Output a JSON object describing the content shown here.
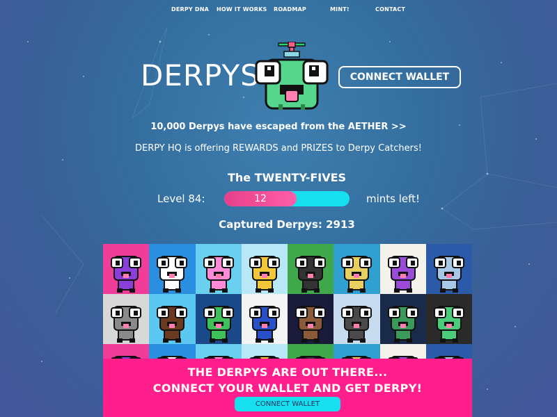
{
  "nav": {
    "items": [
      "DERPY DNA",
      "HOW IT WORKS",
      "ROADMAP",
      "MINT!",
      "CONTACT"
    ]
  },
  "hero": {
    "title": "DERPYS",
    "connect_label": "CONNECT WALLET",
    "mascot_icon": "derpy-frog-helicopter-icon"
  },
  "intro": {
    "line1": "10,000 Derpys have escaped from the AETHER >>",
    "line2": "DERPY HQ is offering REWARDS and PRIZES to Derpy Catchers!"
  },
  "mint": {
    "section_title": "The TWENTY-FIVES",
    "level_label": "Level 84:",
    "mints_left_value": "12",
    "mints_left_fraction": 0.58,
    "mints_left_label": "mints left!",
    "captured_label": "Captured Derpys: 2913"
  },
  "gallery": {
    "tiles": [
      {
        "bg": "#f03d9a",
        "body": "#8a3fd8",
        "icon": "pirate-derpy-icon"
      },
      {
        "bg": "#2a8fe0",
        "body": "#ffffff",
        "icon": "white-cat-derpy-icon"
      },
      {
        "bg": "#6ad0f0",
        "body": "#ff8ad8",
        "icon": "rainbow-derpy-icon"
      },
      {
        "bg": "#b8e8f8",
        "body": "#f2c83a",
        "icon": "gold-derpy-icon"
      },
      {
        "bg": "#3fa84a",
        "body": "#333333",
        "icon": "gorilla-derpy-icon"
      },
      {
        "bg": "#2fa0d0",
        "body": "#e8d060",
        "icon": "elf-derpy-icon"
      },
      {
        "bg": "#f4f2ec",
        "body": "#9a4bd8",
        "icon": "crowned-derpy-icon"
      },
      {
        "bg": "#2a5aa8",
        "body": "#a8c8e8",
        "icon": "robot-derpy-icon"
      },
      {
        "bg": "#d8d8d8",
        "body": "#8a8a8a",
        "icon": "grey-derpy-icon"
      },
      {
        "bg": "#5ac8f0",
        "body": "#6a3a20",
        "icon": "halo-derpy-icon"
      },
      {
        "bg": "#1a4a8a",
        "body": "#3fc05a",
        "icon": "green-derpy-icon"
      },
      {
        "bg": "#f4f4f4",
        "body": "#2a50c8",
        "icon": "glasses-derpy-icon"
      },
      {
        "bg": "#1a1a3a",
        "body": "#8a5a3a",
        "icon": "laser-derpy-icon"
      },
      {
        "bg": "#c8dcf0",
        "body": "#4a4a4a",
        "icon": "mohawk-derpy-icon"
      },
      {
        "bg": "#1a2a4a",
        "body": "#3a9a5a",
        "icon": "pirate-hat-derpy-icon"
      },
      {
        "bg": "#2a2a2a",
        "body": "#4acc7a",
        "icon": "matrix-derpy-icon"
      }
    ]
  },
  "banner": {
    "line1": "THE DERPYS ARE OUT THERE...",
    "line2": "CONNECT YOUR WALLET AND GET DERPY!",
    "connect_label": "CONNECT WALLET"
  }
}
